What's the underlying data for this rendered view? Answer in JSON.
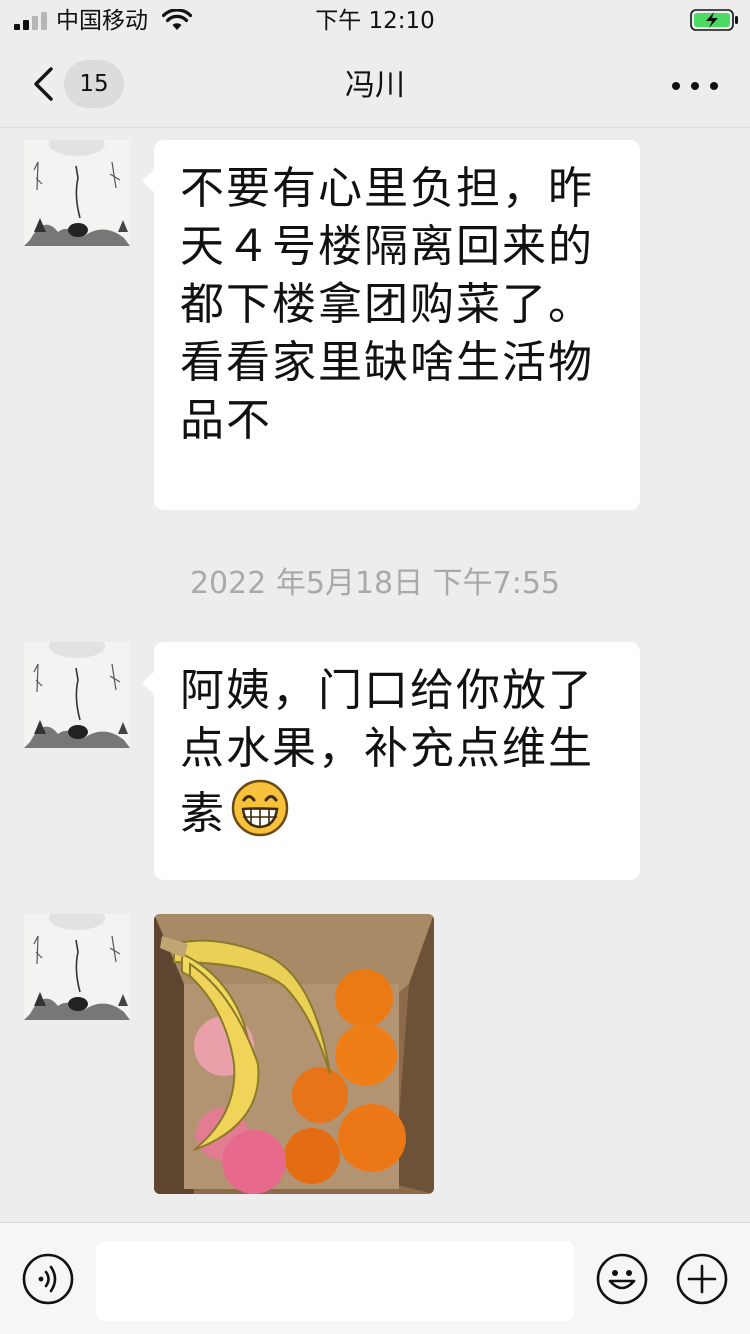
{
  "status_bar": {
    "carrier": "中国移动",
    "time": "下午 12:10"
  },
  "nav": {
    "unread_count": "15",
    "title": "冯川"
  },
  "messages": [
    {
      "sender": "contact",
      "type": "text",
      "text": "不要有心里负担，昨天４号楼隔离回来的都下楼拿团购菜了。看看家里缺啥生活物品不"
    },
    {
      "type": "timestamp",
      "text": "2022 年5月18日 下午7:55"
    },
    {
      "sender": "contact",
      "type": "text",
      "text": "阿姨，门口给你放了点水果，补充点维生素",
      "emoji": "grinning-face-icon"
    },
    {
      "sender": "contact",
      "type": "image",
      "image": "fruit-box-photo"
    }
  ],
  "input": {
    "value": "",
    "placeholder": ""
  },
  "icons": {
    "back": "chevron-left-icon",
    "more": "more-dots-icon",
    "voice": "voice-icon",
    "emoji": "emoji-icon",
    "plus": "plus-icon"
  },
  "colors": {
    "background": "#ededed",
    "bubble": "#ffffff",
    "battery_charging": "#4cd964"
  }
}
